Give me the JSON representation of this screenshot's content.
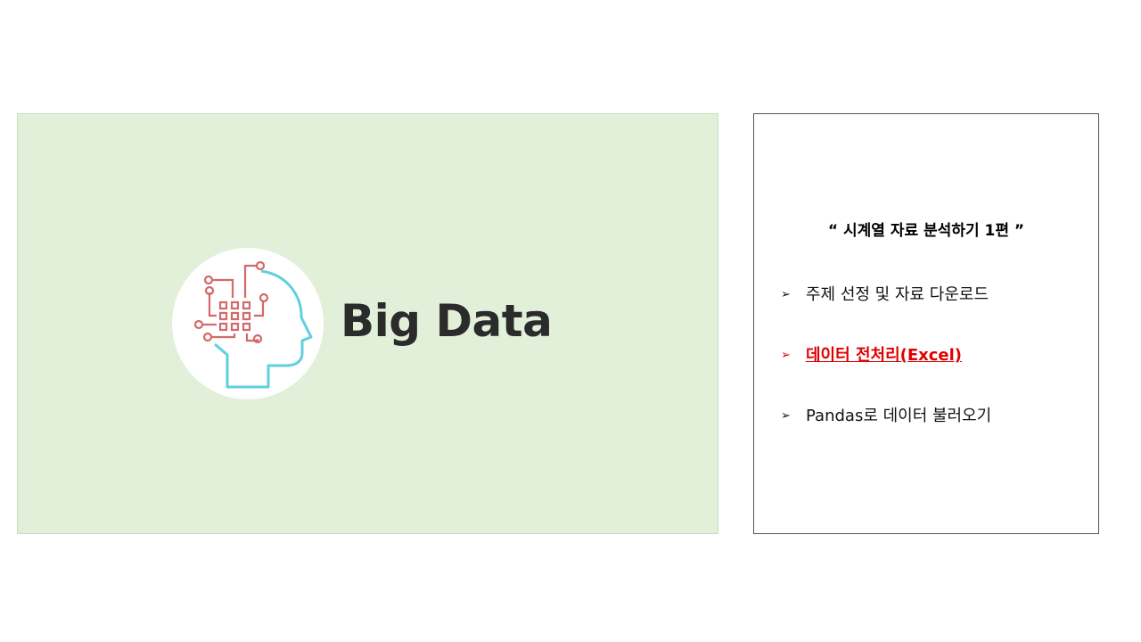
{
  "hero": {
    "logo_text": "Big Data",
    "colors": {
      "background": "#e2efd9",
      "circuit": "#d26a6a",
      "head_outline": "#5fd0de",
      "text": "#2b2b2b"
    },
    "icon": "brain-circuit-icon"
  },
  "panel": {
    "title": "“ 시계열 자료 분석하기 1편 ”",
    "items": [
      {
        "bullet": "➢",
        "label": "주제 선정 및 자료 다운로드",
        "active": false
      },
      {
        "bullet": "➢",
        "label": "데이터 전처리(Excel)",
        "active": true
      },
      {
        "bullet": "➢",
        "label": "Pandas로 데이터 불러오기",
        "active": false
      }
    ],
    "active_color": "#e00000"
  }
}
